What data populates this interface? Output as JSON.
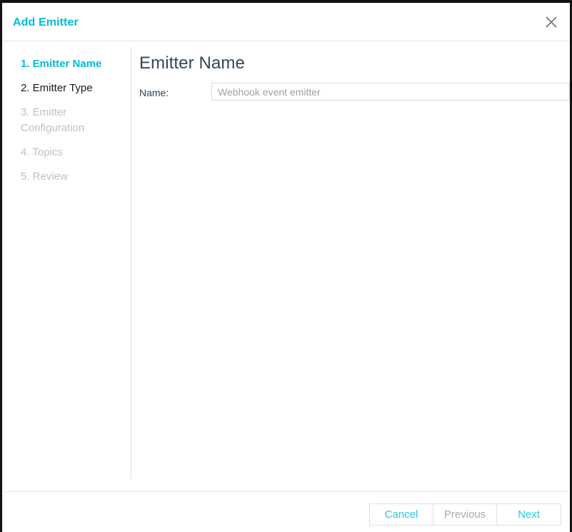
{
  "window": {
    "title": "Add Emitter",
    "close_icon": "close-icon"
  },
  "steps": [
    {
      "label": "1. Emitter Name",
      "state": "active"
    },
    {
      "label": "2. Emitter Type",
      "state": "visited"
    },
    {
      "label": "3. Emitter Configuration",
      "state": "disabled"
    },
    {
      "label": "4. Topics",
      "state": "disabled"
    },
    {
      "label": "5. Review",
      "state": "disabled"
    }
  ],
  "content": {
    "heading": "Emitter Name",
    "name_label": "Name:",
    "name_value": "",
    "name_placeholder": "Webhook event emitter"
  },
  "footer": {
    "cancel_label": "Cancel",
    "previous_label": "Previous",
    "next_label": "Next"
  },
  "colors": {
    "accent": "#00bcd4",
    "button_accent": "#2ec7de",
    "heading": "#32465a",
    "disabled_text": "#c0c0c0"
  }
}
